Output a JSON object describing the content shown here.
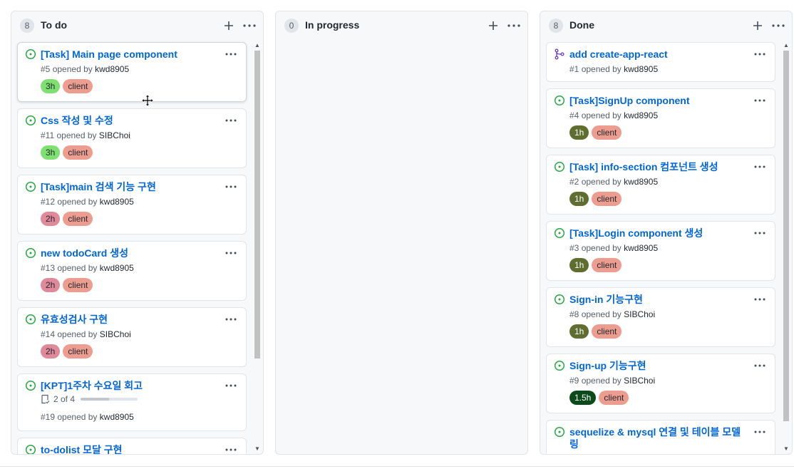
{
  "columns": [
    {
      "count": "8",
      "title": "To do",
      "cards": [
        {
          "title": "[Task] Main page component",
          "number": "#5",
          "opened_by": "opened by",
          "author": "kwd8905",
          "labels": [
            {
              "text": "3h",
              "cls": "lbl-3h"
            },
            {
              "text": "client",
              "cls": "lbl-client"
            }
          ],
          "icon": "issue-open-icon"
        },
        {
          "title": "Css 작성 및 수정",
          "number": "#11",
          "opened_by": "opened by",
          "author": "SIBChoi",
          "labels": [
            {
              "text": "3h",
              "cls": "lbl-3h"
            },
            {
              "text": "client",
              "cls": "lbl-client"
            }
          ],
          "icon": "issue-open-icon"
        },
        {
          "title": "[Task]main 검색 기능 구현",
          "number": "#12",
          "opened_by": "opened by",
          "author": "kwd8905",
          "labels": [
            {
              "text": "2h",
              "cls": "lbl-2h"
            },
            {
              "text": "client",
              "cls": "lbl-client"
            }
          ],
          "icon": "issue-open-icon"
        },
        {
          "title": "new todoCard 생성",
          "number": "#13",
          "opened_by": "opened by",
          "author": "kwd8905",
          "labels": [
            {
              "text": "2h",
              "cls": "lbl-2h"
            },
            {
              "text": "client",
              "cls": "lbl-client"
            }
          ],
          "icon": "issue-open-icon"
        },
        {
          "title": "유효성검사 구현",
          "number": "#14",
          "opened_by": "opened by",
          "author": "SIBChoi",
          "labels": [
            {
              "text": "2h",
              "cls": "lbl-2h"
            },
            {
              "text": "client",
              "cls": "lbl-client"
            }
          ],
          "icon": "issue-open-icon"
        },
        {
          "title": "[KPT]1주차 수요일 회고",
          "number": "#19",
          "opened_by": "opened by",
          "author": "kwd8905",
          "tasks": "2 of 4",
          "task_progress": 0.5,
          "labels": [],
          "icon": "issue-open-icon"
        },
        {
          "title": "to-dolist 모달 구현",
          "number": "",
          "opened_by": "",
          "author": "",
          "labels": [],
          "icon": "issue-open-icon"
        }
      ]
    },
    {
      "count": "0",
      "title": "In progress",
      "cards": []
    },
    {
      "count": "8",
      "title": "Done",
      "cards": [
        {
          "title": "add create-app-react",
          "number": "#1",
          "opened_by": "opened by",
          "author": "kwd8905",
          "labels": [],
          "icon": "pull-request-merged-icon"
        },
        {
          "title": "[Task]SignUp component",
          "number": "#4",
          "opened_by": "opened by",
          "author": "kwd8905",
          "labels": [
            {
              "text": "1h",
              "cls": "lbl-1h"
            },
            {
              "text": "client",
              "cls": "lbl-client"
            }
          ],
          "icon": "issue-open-icon"
        },
        {
          "title": "[Task] info-section 컴포넌트 생성",
          "number": "#2",
          "opened_by": "opened by",
          "author": "kwd8905",
          "labels": [
            {
              "text": "1h",
              "cls": "lbl-1h"
            },
            {
              "text": "client",
              "cls": "lbl-client"
            }
          ],
          "icon": "issue-open-icon"
        },
        {
          "title": "[Task]Login component 생성",
          "number": "#3",
          "opened_by": "opened by",
          "author": "kwd8905",
          "labels": [
            {
              "text": "1h",
              "cls": "lbl-1h"
            },
            {
              "text": "client",
              "cls": "lbl-client"
            }
          ],
          "icon": "issue-open-icon"
        },
        {
          "title": "Sign-in 기능구현",
          "number": "#8",
          "opened_by": "opened by",
          "author": "SIBChoi",
          "labels": [
            {
              "text": "1h",
              "cls": "lbl-1h"
            },
            {
              "text": "client",
              "cls": "lbl-client"
            }
          ],
          "icon": "issue-open-icon"
        },
        {
          "title": "Sign-up 기능구현",
          "number": "#9",
          "opened_by": "opened by",
          "author": "SIBChoi",
          "labels": [
            {
              "text": "1.5h",
              "cls": "lbl-15h"
            },
            {
              "text": "client",
              "cls": "lbl-client"
            }
          ],
          "icon": "issue-open-icon"
        },
        {
          "title": "sequelize & mysql 연결 및 테이블 모델링",
          "number": "",
          "opened_by": "",
          "author": "",
          "labels": [],
          "icon": "issue-open-icon"
        }
      ]
    }
  ],
  "colors": {
    "issue_open": "#28a745",
    "pr_merged": "#6f42c1",
    "link": "#0366d6"
  }
}
